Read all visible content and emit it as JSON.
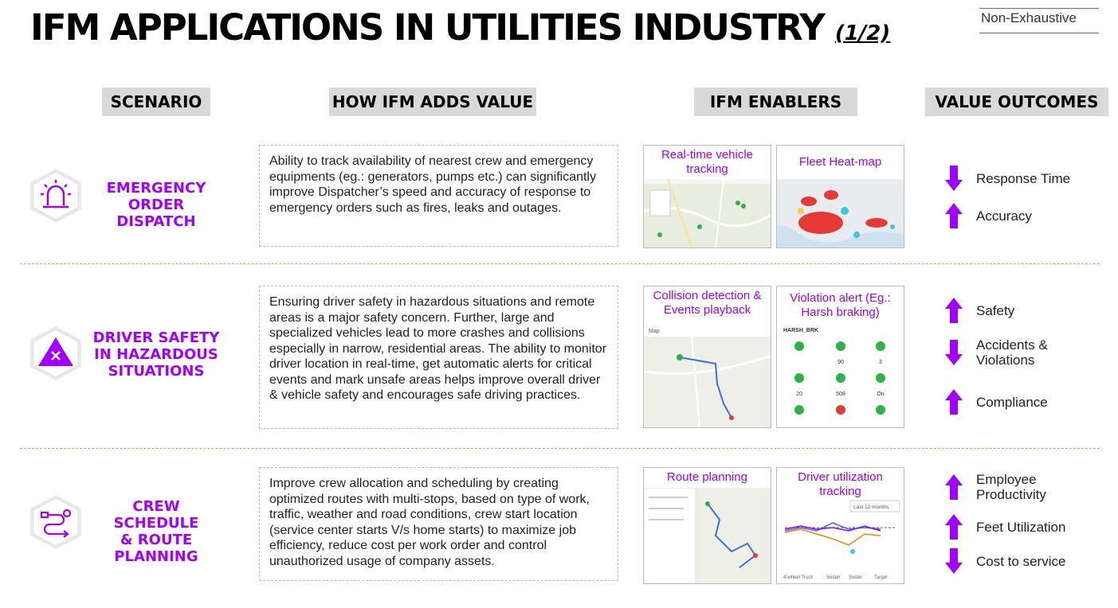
{
  "title": {
    "main": "IFM APPLICATIONS IN UTILITIES INDUSTRY",
    "sub": "(1/2)"
  },
  "tag": "Non-Exhaustive",
  "headers": {
    "scenario": "SCENARIO",
    "how": "HOW IFM ADDS VALUE",
    "enablers": "IFM ENABLERS",
    "outcomes": "VALUE OUTCOMES"
  },
  "rows": [
    {
      "scenario": [
        "EMERGENCY",
        "ORDER DISPATCH"
      ],
      "icon": "siren-icon",
      "description": "Ability to track availability of nearest crew and emergency equipments (eg.: generators, pumps etc.) can significantly improve Dispatcher’s speed and accuracy of response to emergency orders such as fires, leaks and outages.",
      "enablers": [
        "Real-time vehicle tracking",
        "Fleet Heat-map"
      ],
      "outcomes": [
        {
          "direction": "down",
          "label": "Response Time"
        },
        {
          "direction": "up",
          "label": "Accuracy"
        }
      ]
    },
    {
      "scenario": [
        "DRIVER SAFETY",
        "IN HAZARDOUS",
        "SITUATIONS"
      ],
      "icon": "warning-x-icon",
      "description": "Ensuring driver safety in hazardous situations and remote areas is a major safety concern. Further, large and specialized vehicles lead to more crashes and collisions especially in narrow, residential areas. The ability to monitor driver location in real-time, get automatic alerts for critical events and mark unsafe areas helps improve overall driver & vehicle safety and encourages safe driving practices.",
      "enablers": [
        "Collision detection & Events playback",
        "Violation alert (Eg.: Harsh braking)"
      ],
      "outcomes": [
        {
          "direction": "up",
          "label": "Safety"
        },
        {
          "direction": "down",
          "label": "Accidents & Violations"
        },
        {
          "direction": "up",
          "label": "Compliance"
        }
      ]
    },
    {
      "scenario": [
        "CREW SCHEDULE",
        "& ROUTE",
        "PLANNING"
      ],
      "icon": "route-icon",
      "description": "Improve crew allocation and scheduling by creating optimized routes with multi-stops, based on type of work, traffic, weather and road conditions, crew start location (service center starts V/s home starts) to maximize job efficiency, reduce cost per work order and control unauthorized usage of company assets.",
      "enablers": [
        "Route planning",
        "Driver utilization tracking"
      ],
      "outcomes": [
        {
          "direction": "up",
          "label": "Employee Productivity"
        },
        {
          "direction": "up",
          "label": "Feet Utilization"
        },
        {
          "direction": "down",
          "label": "Cost to service"
        }
      ]
    }
  ],
  "thumbs": {
    "collision_map_label": "Map",
    "violation_driver": "HARSH_BRK",
    "violation_values": [
      "90",
      "3",
      "20",
      "508",
      "On"
    ],
    "util_filter": "Last 12 months",
    "util_legend": [
      "4-wheel Truck",
      "Sedan",
      "Sedan",
      "Target"
    ]
  },
  "colors": {
    "accent": "#a100ff",
    "separator": "#7cd55a"
  }
}
